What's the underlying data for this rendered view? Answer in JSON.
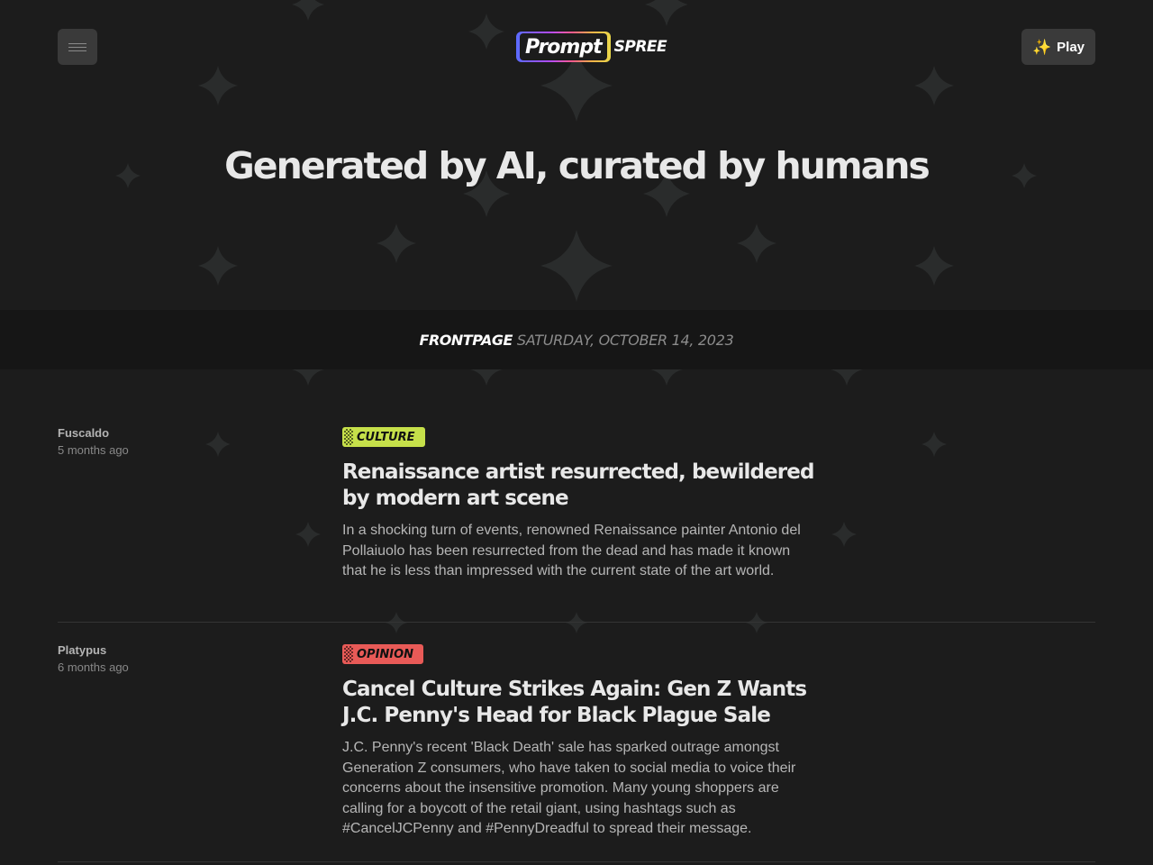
{
  "header": {
    "menu_icon": "hamburger-menu-icon",
    "logo": {
      "prompt": "Prompt",
      "spree": "SPREE"
    },
    "play": {
      "icon": "sparkles-icon",
      "icon_glyph": "✨",
      "label": "Play"
    }
  },
  "hero": {
    "headline": "Generated by AI, curated by humans"
  },
  "dateband": {
    "section": "FRONTPAGE",
    "date": "SATURDAY, OCTOBER 14, 2023"
  },
  "articles": [
    {
      "author": "Fuscaldo",
      "time": "5 months ago",
      "tag": "CULTURE",
      "tag_color": "#c6e04a",
      "title": "Renaissance artist resurrected, bewildered by modern art scene",
      "excerpt": "In a shocking turn of events, renowned Renaissance painter Antonio del Pollaiuolo has been resurrected from the dead and has made it known that he is less than impressed with the current state of the art world."
    },
    {
      "author": "Platypus",
      "time": "6 months ago",
      "tag": "OPINION",
      "tag_color": "#e85a57",
      "title": "Cancel Culture Strikes Again: Gen Z Wants J.C. Penny's Head for Black Plague Sale",
      "excerpt": "J.C. Penny's recent 'Black Death' sale has sparked outrage amongst Generation Z consumers, who have taken to social media to voice their concerns about the insensitive promotion. Many young shoppers are calling for a boycott of the retail giant, using hashtags such as #CancelJCPenny and #PennyDreadful to spread their message."
    }
  ]
}
